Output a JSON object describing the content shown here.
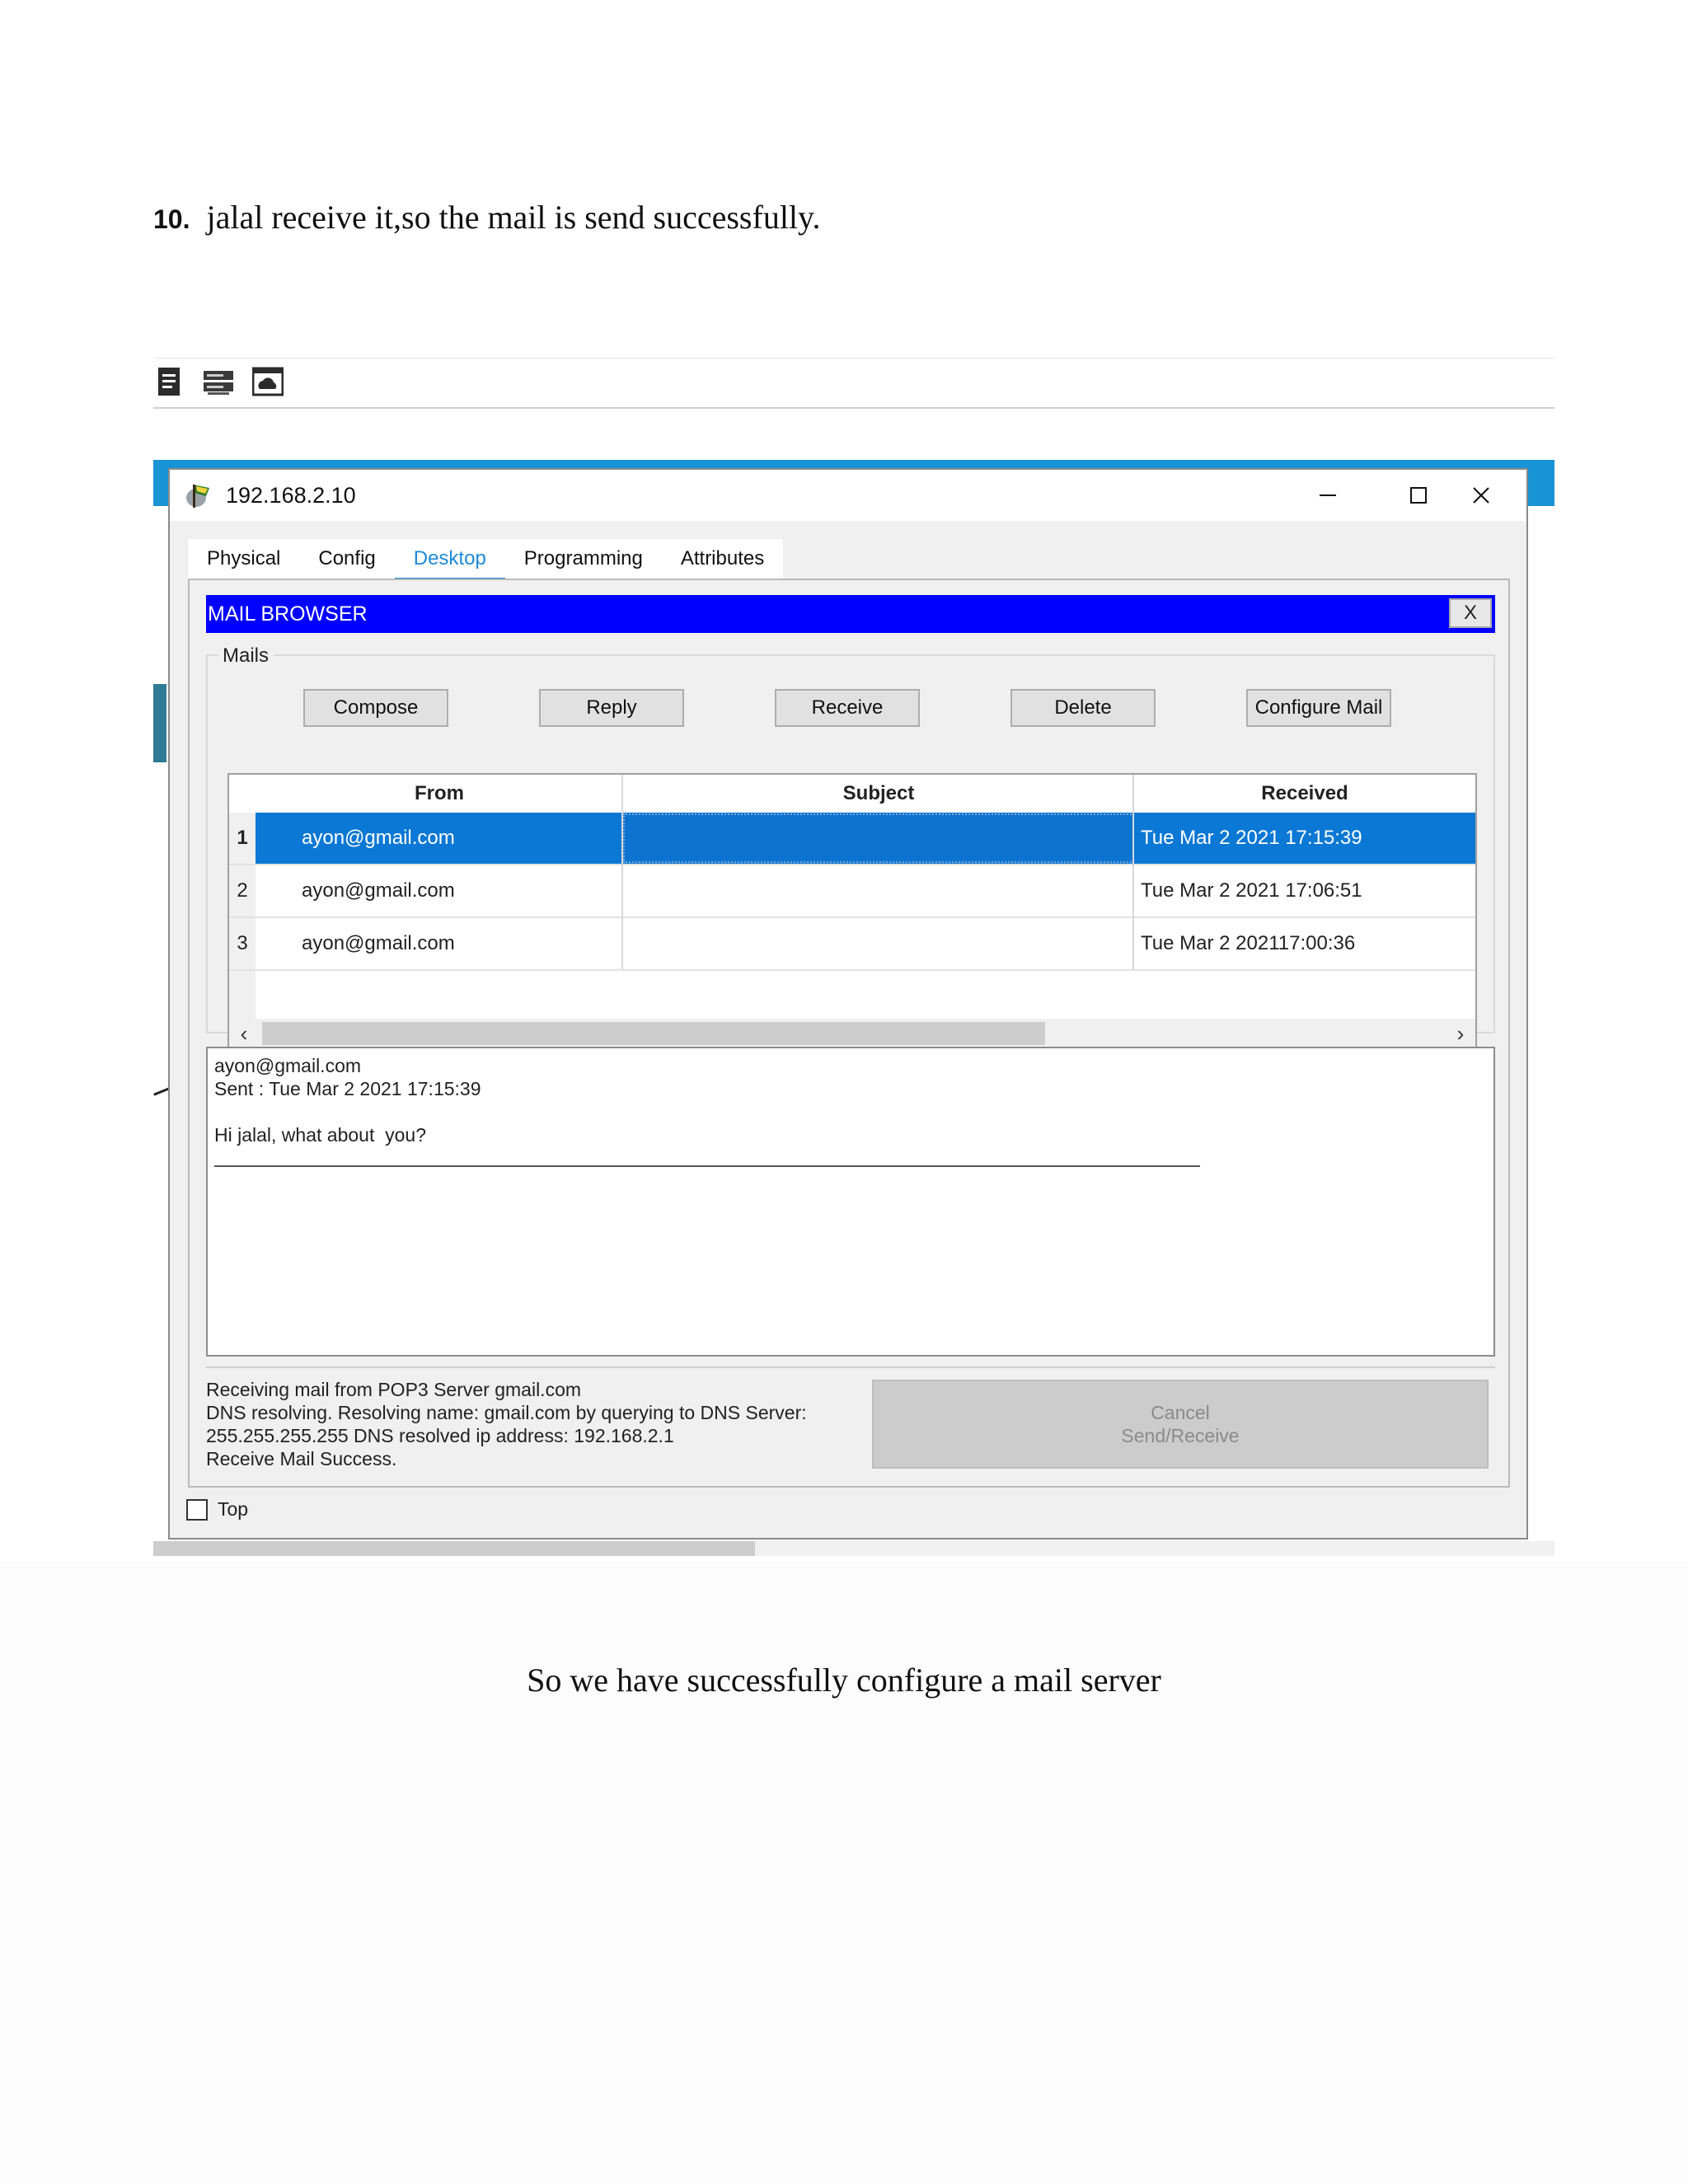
{
  "document": {
    "step_number": "10.",
    "step_text": "jalal receive it,so the mail is send successfully.",
    "conclusion": "So we have successfully configure a mail server",
    "toolbar_icons": [
      "document-icon",
      "server-icon",
      "cloud-window-icon"
    ]
  },
  "window": {
    "title": "192.168.2.10",
    "controls": [
      "minimize-icon",
      "maximize-icon",
      "close-icon"
    ],
    "tabs": [
      {
        "label": "Physical",
        "active": false
      },
      {
        "label": "Config",
        "active": false
      },
      {
        "label": "Desktop",
        "active": true
      },
      {
        "label": "Programming",
        "active": false
      },
      {
        "label": "Attributes",
        "active": false
      }
    ]
  },
  "mail_browser": {
    "title": "MAIL BROWSER",
    "close_label": "X",
    "group_label": "Mails",
    "buttons": {
      "compose": "Compose",
      "reply": "Reply",
      "receive": "Receive",
      "delete": "Delete",
      "configure": "Configure Mail"
    },
    "columns": {
      "from": "From",
      "subject": "Subject",
      "received": "Received"
    },
    "rows": [
      {
        "num": "1",
        "from": "ayon@gmail.com",
        "subject": "",
        "received": "Tue Mar 2 2021 17:15:39",
        "selected": true
      },
      {
        "num": "2",
        "from": "ayon@gmail.com",
        "subject": "",
        "received": "Tue Mar 2 2021 17:06:51",
        "selected": false
      },
      {
        "num": "3",
        "from": "ayon@gmail.com",
        "subject": "",
        "received": "Tue Mar 2 202117:00:36",
        "selected": false
      }
    ],
    "message": {
      "from": "ayon@gmail.com",
      "sent": "Sent : Tue Mar 2 2021 17:15:39",
      "body": "Hi jalal, what about  you?"
    },
    "status_lines": [
      "Receiving mail from POP3 Server gmail.com",
      "DNS resolving. Resolving name: gmail.com by querying to DNS Server:",
      "255.255.255.255  DNS resolved ip address: 192.168.2.1",
      "Receive Mail Success."
    ],
    "cancel_button": {
      "line1": "Cancel",
      "line2": "Send/Receive"
    },
    "top_checkbox": {
      "label": "Top",
      "checked": false
    }
  },
  "colors": {
    "mail_browser_bar": "#0000ff",
    "selected_row": "#0a78d4",
    "active_tab": "#1f8ad8",
    "backdrop_bar": "#1893d4"
  }
}
